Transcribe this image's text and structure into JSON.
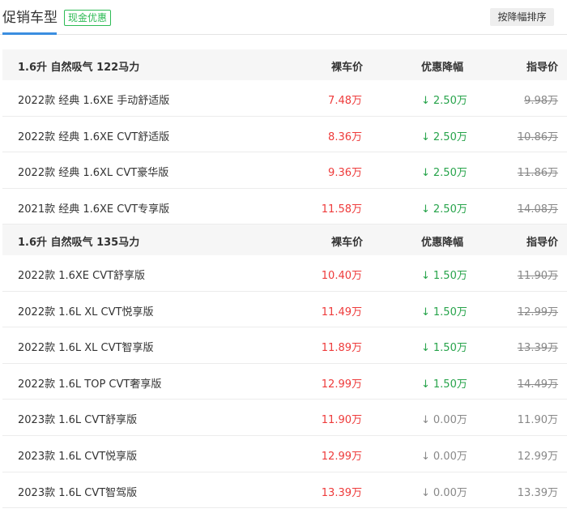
{
  "tabs": {
    "active": "促销车型",
    "badge": "现金优惠",
    "sort_button": "按降幅排序"
  },
  "columns": {
    "price": "裸车价",
    "discount": "优惠降幅",
    "guide": "指导价"
  },
  "groups": [
    {
      "title": "1.6升 自然吸气 122马力",
      "rows": [
        {
          "name": "2022款 经典 1.6XE 手动舒适版",
          "price": "7.48万",
          "discount": "2.50万",
          "guide": "9.98万"
        },
        {
          "name": "2022款 经典 1.6XE CVT舒适版",
          "price": "8.36万",
          "discount": "2.50万",
          "guide": "10.86万"
        },
        {
          "name": "2022款 经典 1.6XL CVT豪华版",
          "price": "9.36万",
          "discount": "2.50万",
          "guide": "11.86万"
        },
        {
          "name": "2021款 经典 1.6XE CVT专享版",
          "price": "11.58万",
          "discount": "2.50万",
          "guide": "14.08万"
        }
      ]
    },
    {
      "title": "1.6升 自然吸气 135马力",
      "rows": [
        {
          "name": "2022款 1.6XE CVT舒享版",
          "price": "10.40万",
          "discount": "1.50万",
          "guide": "11.90万"
        },
        {
          "name": "2022款 1.6L XL CVT悦享版",
          "price": "11.49万",
          "discount": "1.50万",
          "guide": "12.99万"
        },
        {
          "name": "2022款 1.6L XL CVT智享版",
          "price": "11.89万",
          "discount": "1.50万",
          "guide": "13.39万"
        },
        {
          "name": "2022款 1.6L TOP CVT奢享版",
          "price": "12.99万",
          "discount": "1.50万",
          "guide": "14.49万"
        },
        {
          "name": "2023款 1.6L CVT舒享版",
          "price": "11.90万",
          "discount": "0.00万",
          "guide": "11.90万"
        },
        {
          "name": "2023款 1.6L CVT悦享版",
          "price": "12.99万",
          "discount": "0.00万",
          "guide": "12.99万"
        },
        {
          "name": "2023款 1.6L CVT智驾版",
          "price": "13.39万",
          "discount": "0.00万",
          "guide": "13.39万"
        }
      ]
    }
  ],
  "icons": {
    "discount_arrow": "down-arrow-icon"
  },
  "colors": {
    "accent": "#3b8ee0",
    "badge": "#2dbb55",
    "price": "#ee3b3b",
    "discount": "#26a34a",
    "muted": "#888888"
  }
}
